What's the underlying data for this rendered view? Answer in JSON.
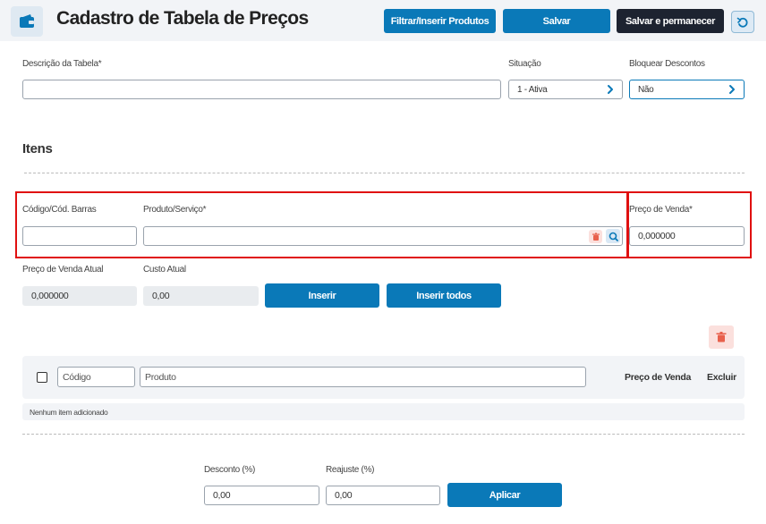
{
  "header": {
    "title": "Cadastro de Tabela de Preços",
    "filter_button": "Filtrar/Inserir Produtos",
    "save_button": "Salvar",
    "save_stay_button": "Salvar e permanecer"
  },
  "form": {
    "description_label": "Descrição da Tabela*",
    "description_value": "",
    "status_label": "Situação",
    "status_value": "1 - Ativa",
    "block_discounts_label": "Bloquear Descontos",
    "block_discounts_value": "Não"
  },
  "items": {
    "section_title": "Itens",
    "code_label": "Código/Cód. Barras",
    "code_value": "",
    "product_label": "Produto/Serviço*",
    "product_value": "",
    "sale_price_label": "Preço de Venda*",
    "sale_price_value": "0,000000",
    "current_price_label": "Preço de Venda Atual",
    "current_price_value": "0,000000",
    "current_cost_label": "Custo Atual",
    "current_cost_value": "0,00",
    "insert_button": "Inserir",
    "insert_all_button": "Inserir todos"
  },
  "table": {
    "code_placeholder": "Código",
    "product_placeholder": "Produto",
    "price_header": "Preço de Venda",
    "delete_header": "Excluir",
    "empty_message": "Nenhum item adicionado"
  },
  "adjust": {
    "discount_label": "Desconto (%)",
    "discount_value": "0,00",
    "readjust_label": "Reajuste (%)",
    "readjust_value": "0,00",
    "apply_button": "Aplicar"
  },
  "colors": {
    "primary": "#0a79b8",
    "dark": "#1d2330",
    "highlight": "#e01010",
    "danger_icon": "#e8604c"
  }
}
